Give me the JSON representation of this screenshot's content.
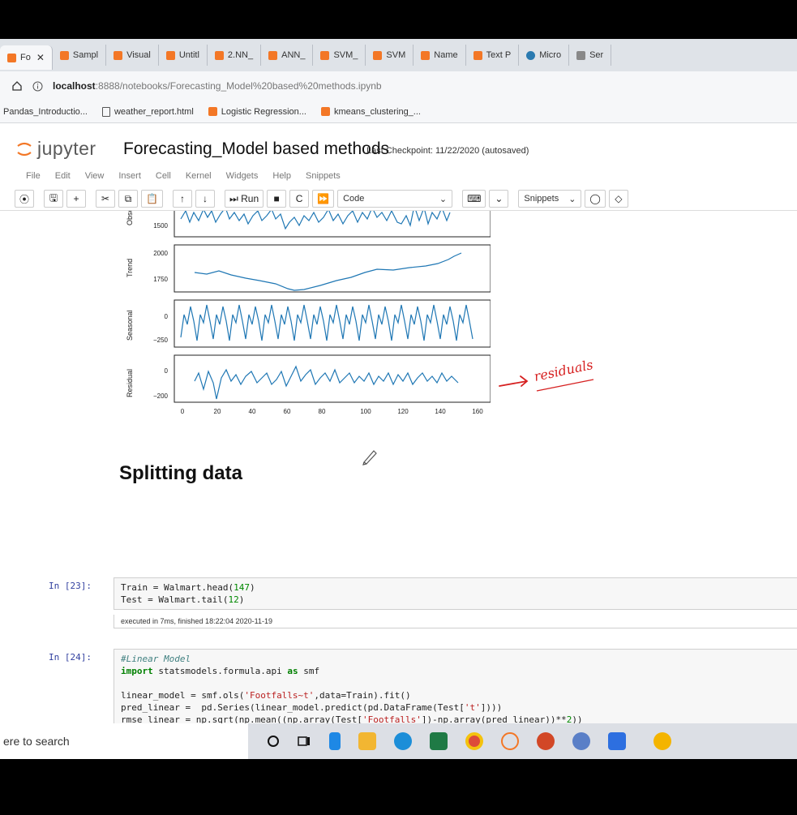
{
  "browser": {
    "tabs": [
      {
        "label": "Fo",
        "active": true
      },
      {
        "label": "Sampl"
      },
      {
        "label": "Visual"
      },
      {
        "label": "Untitl"
      },
      {
        "label": "2.NN_"
      },
      {
        "label": "ANN_"
      },
      {
        "label": "SVM_"
      },
      {
        "label": "SVM"
      },
      {
        "label": "Name"
      },
      {
        "label": "Text P"
      },
      {
        "label": "Micro"
      },
      {
        "label": "Ser"
      }
    ],
    "url_host": "localhost",
    "url_path": ":8888/notebooks/Forecasting_Model%20based%20methods.ipynb",
    "bookmarks": [
      "Pandas_Introductio...",
      "weather_report.html",
      "Logistic Regression...",
      "kmeans_clustering_..."
    ]
  },
  "jupyter": {
    "logo_text": "jupyter",
    "title": "Forecasting_Model based methods",
    "checkpoint": "Last Checkpoint: 11/22/2020  (autosaved)",
    "menu": [
      "File",
      "Edit",
      "View",
      "Insert",
      "Cell",
      "Kernel",
      "Widgets",
      "Help",
      "Snippets"
    ],
    "toolbar": {
      "run_label": "Run",
      "cell_type": "Code",
      "snippets_label": "Snippets"
    }
  },
  "notebook": {
    "plot_labels": {
      "observed": "Observ",
      "trend": "Trend",
      "seasonal": "Seasonal",
      "residual": "Residual",
      "observed_ticks": [
        "1500"
      ],
      "trend_ticks": [
        "2000",
        "1750"
      ],
      "seasonal_ticks": [
        "0",
        "−250"
      ],
      "residual_ticks": [
        "0",
        "−200"
      ],
      "x_ticks": [
        "0",
        "20",
        "40",
        "60",
        "80",
        "100",
        "120",
        "140",
        "160"
      ]
    },
    "annotation": "residuals",
    "section_heading": "Splitting data",
    "cells": [
      {
        "prompt": "In [23]:",
        "exec_info": "executed in 7ms, finished 18:22:04 2020-11-19"
      },
      {
        "prompt": "In [24]:"
      }
    ]
  },
  "taskbar": {
    "search_text": "ere to search"
  },
  "colors": {
    "plot_line": "#1f77b4",
    "annotation": "#d62020",
    "jupyter_orange": "#f37726"
  }
}
